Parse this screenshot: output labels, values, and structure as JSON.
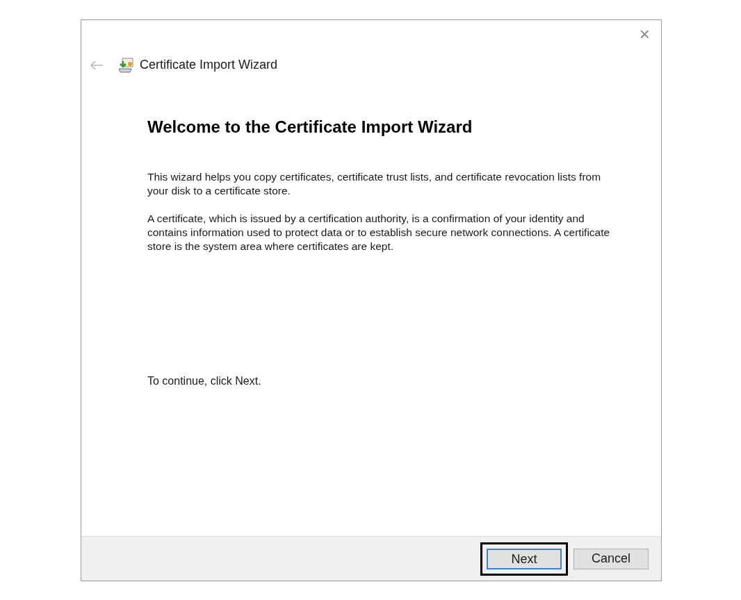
{
  "window": {
    "title": "Certificate Import Wizard",
    "close": "×",
    "back_enabled": false
  },
  "heading": "Welcome to the Certificate Import Wizard",
  "paragraphs": [
    "This wizard helps you copy certificates, certificate trust lists, and certificate revocation lists from your disk to a certificate store.",
    "A certificate, which is issued by a certification authority, is a confirmation of your identity and contains information used to protect data or to establish secure network connections. A certificate store is the system area where certificates are kept."
  ],
  "continue_text": "To continue, click Next.",
  "buttons": [
    {
      "label": "Next",
      "default": true,
      "highlighted": true
    },
    {
      "label": "Cancel",
      "default": false,
      "highlighted": false
    }
  ]
}
